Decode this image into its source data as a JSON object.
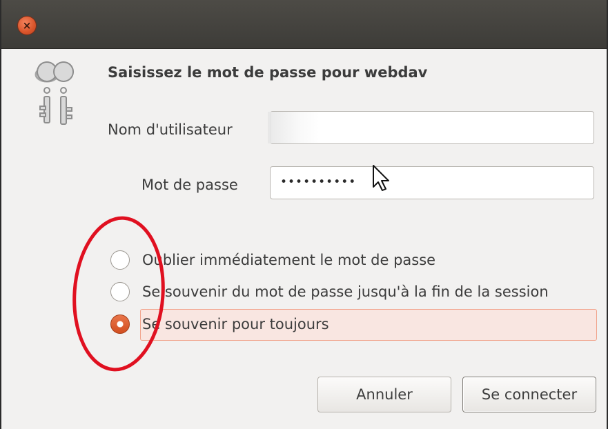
{
  "window": {
    "close_icon": "close-icon",
    "dialog_icon": "keys-icon"
  },
  "dialog": {
    "heading": "Saisissez le mot de passe pour webdav",
    "username_label": "Nom d'utilisateur",
    "username_value": "",
    "password_label": "Mot de passe",
    "password_display": "••••••••••"
  },
  "remember_options": [
    {
      "label": "Oublier immédiatement le mot de passe",
      "checked": false
    },
    {
      "label": "Se souvenir du mot de passe jusqu'à la fin de la session",
      "checked": false
    },
    {
      "label": "Se souvenir pour toujours",
      "checked": true
    }
  ],
  "buttons": {
    "cancel": "Annuler",
    "connect": "Se connecter"
  },
  "colors": {
    "accent": "#dd5a2b",
    "annotation": "#e01020",
    "selection_bg": "#f9e6e1"
  }
}
